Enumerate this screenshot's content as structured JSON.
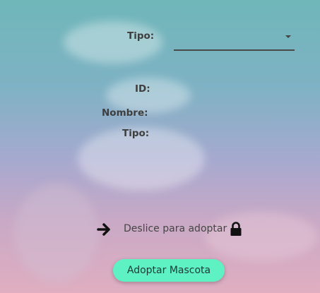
{
  "form": {
    "tipo_select_label": "Tipo:",
    "tipo_select_value": "",
    "id_label": "ID:",
    "nombre_label": "Nombre:",
    "tipo_label": "Tipo:"
  },
  "slide": {
    "label": "Deslice para adoptar",
    "arrow_icon": "arrow-right-icon",
    "lock_icon": "lock-icon"
  },
  "button": {
    "label": "Adoptar Mascota",
    "color": "#5ef1c2"
  }
}
